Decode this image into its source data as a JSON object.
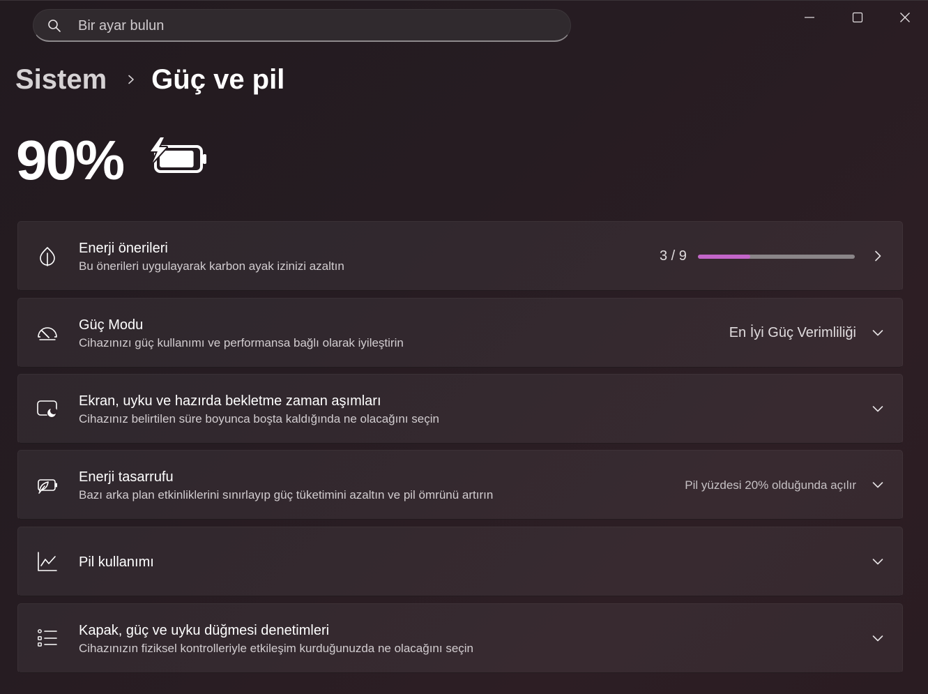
{
  "search": {
    "placeholder": "Bir ayar bulun"
  },
  "breadcrumb": {
    "parent": "Sistem",
    "current": "Güç ve pil"
  },
  "battery": {
    "percent_label": "90%",
    "percent": 90,
    "charging": true
  },
  "cards": [
    {
      "id": "energy-recommendations",
      "icon": "leaf-icon",
      "title": "Enerji önerileri",
      "subtitle": "Bu önerileri uygulayarak karbon ayak izinizi azaltın",
      "progress_label": "3 / 9",
      "progress_fraction": 0.3333,
      "action": "chevron-right"
    },
    {
      "id": "power-mode",
      "icon": "gauge-icon",
      "title": "Güç Modu",
      "subtitle": "Cihazınızı güç kullanımı ve performansa bağlı olarak iyileştirin",
      "value": "En İyi Güç Verimliliği",
      "action": "chevron-down"
    },
    {
      "id": "screen-sleep",
      "icon": "screen-moon-icon",
      "title": "Ekran, uyku ve hazırda bekletme zaman aşımları",
      "subtitle": "Cihazınız belirtilen süre boyunca boşta kaldığında ne olacağını seçin",
      "action": "chevron-down"
    },
    {
      "id": "energy-saver",
      "icon": "battery-leaf-icon",
      "title": "Enerji tasarrufu",
      "subtitle": "Bazı arka plan etkinliklerini sınırlayıp güç tüketimini azaltın ve pil ömrünü artırın",
      "value": "Pil yüzdesi 20% olduğunda açılır",
      "action": "chevron-down"
    },
    {
      "id": "battery-usage",
      "icon": "line-chart-icon",
      "title": "Pil kullanımı",
      "action": "chevron-down"
    },
    {
      "id": "lid-power-buttons",
      "icon": "list-icon",
      "title": "Kapak, güç ve uyku düğmesi denetimleri",
      "subtitle": "Cihazınızın fiziksel kontrolleriyle etkileşim kurduğunuzda ne olacağını seçin",
      "action": "chevron-down"
    }
  ],
  "colors": {
    "accent": "#c365c9",
    "track": "#8a8588"
  }
}
